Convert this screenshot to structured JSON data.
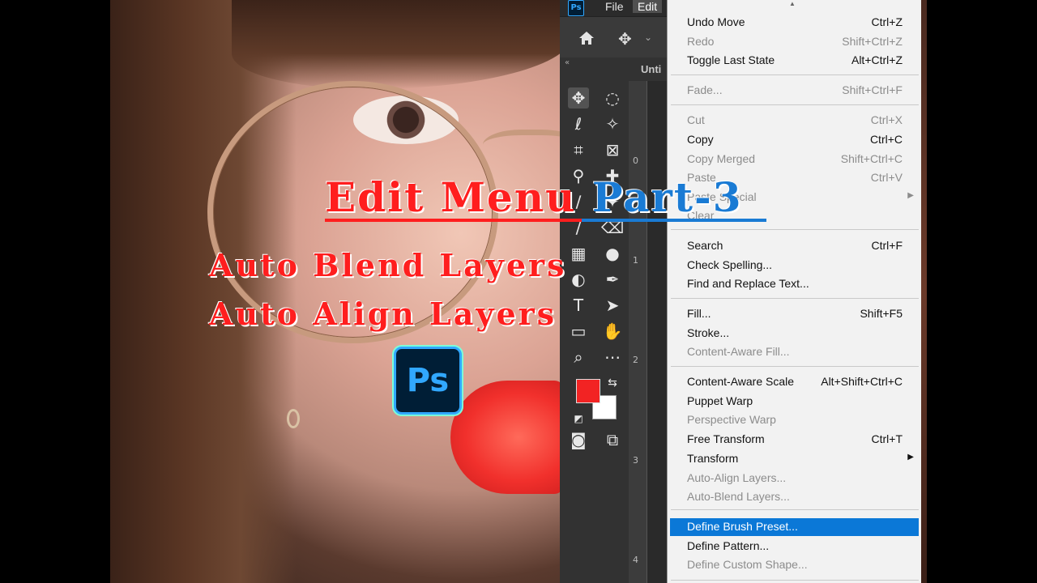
{
  "overlay": {
    "title_main": "Edit Menu",
    "title_part": "Part-3",
    "subtitle_1": "Auto Blend Layers",
    "subtitle_2": "Auto Align Layers",
    "logo_text": "Ps"
  },
  "app": {
    "icon_text": "Ps",
    "menubar": {
      "file": "File",
      "edit": "Edit"
    },
    "doc_tab": "Unti",
    "ruler_marks": [
      "0",
      "1",
      "2",
      "3",
      "4"
    ],
    "colors": {
      "foreground": "#f22323",
      "background": "#ffffff",
      "menu_highlight": "#0b78d7"
    }
  },
  "edit_menu": {
    "items": [
      {
        "label": "Undo Move",
        "shortcut": "Ctrl+Z",
        "disabled": false
      },
      {
        "label": "Redo",
        "shortcut": "Shift+Ctrl+Z",
        "disabled": true
      },
      {
        "label": "Toggle Last State",
        "shortcut": "Alt+Ctrl+Z",
        "disabled": false
      },
      {
        "label": "Fade...",
        "shortcut": "Shift+Ctrl+F",
        "disabled": true
      },
      {
        "label": "Cut",
        "shortcut": "Ctrl+X",
        "disabled": true
      },
      {
        "label": "Copy",
        "shortcut": "Ctrl+C",
        "disabled": false
      },
      {
        "label": "Copy Merged",
        "shortcut": "Shift+Ctrl+C",
        "disabled": true
      },
      {
        "label": "Paste",
        "shortcut": "Ctrl+V",
        "disabled": true
      },
      {
        "label": "Paste Special",
        "shortcut": "",
        "disabled": true,
        "submenu": true
      },
      {
        "label": "Clear",
        "shortcut": "",
        "disabled": true
      },
      {
        "label": "Search",
        "shortcut": "Ctrl+F",
        "disabled": false
      },
      {
        "label": "Check Spelling...",
        "shortcut": "",
        "disabled": false
      },
      {
        "label": "Find and Replace Text...",
        "shortcut": "",
        "disabled": false
      },
      {
        "label": "Fill...",
        "shortcut": "Shift+F5",
        "disabled": false
      },
      {
        "label": "Stroke...",
        "shortcut": "",
        "disabled": false
      },
      {
        "label": "Content-Aware Fill...",
        "shortcut": "",
        "disabled": true
      },
      {
        "label": "Content-Aware Scale",
        "shortcut": "Alt+Shift+Ctrl+C",
        "disabled": false
      },
      {
        "label": "Puppet Warp",
        "shortcut": "",
        "disabled": false
      },
      {
        "label": "Perspective Warp",
        "shortcut": "",
        "disabled": true
      },
      {
        "label": "Free Transform",
        "shortcut": "Ctrl+T",
        "disabled": false
      },
      {
        "label": "Transform",
        "shortcut": "",
        "disabled": false,
        "submenu": true
      },
      {
        "label": "Auto-Align Layers...",
        "shortcut": "",
        "disabled": true
      },
      {
        "label": "Auto-Blend Layers...",
        "shortcut": "",
        "disabled": true
      },
      {
        "label": "Define Brush Preset...",
        "shortcut": "",
        "disabled": false,
        "highlighted": true
      },
      {
        "label": "Define Pattern...",
        "shortcut": "",
        "disabled": false
      },
      {
        "label": "Define Custom Shape...",
        "shortcut": "",
        "disabled": true
      }
    ]
  }
}
